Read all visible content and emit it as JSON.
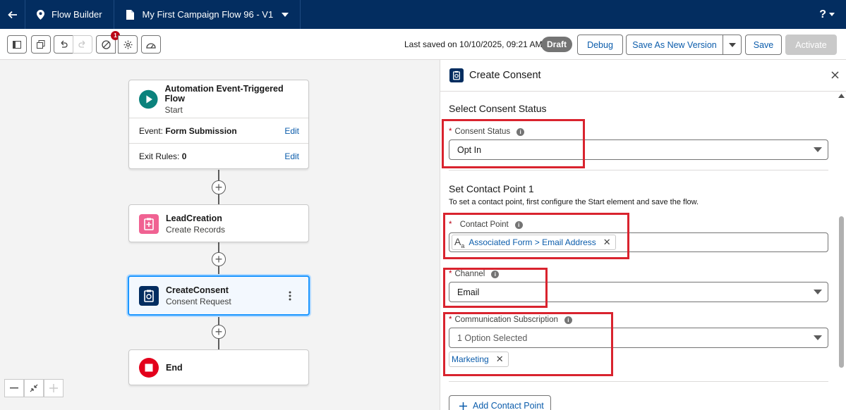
{
  "topbar": {
    "app_name": "Flow Builder",
    "flow_name": "My First Campaign Flow 96 - V1",
    "help": "?"
  },
  "toolbar": {
    "notification_count": "1",
    "last_saved": "Last saved on 10/10/2025, 09:21 AM",
    "status_badge": "Draft",
    "debug_label": "Debug",
    "save_as_new_label": "Save As New Version",
    "save_label": "Save",
    "activate_label": "Activate"
  },
  "canvas": {
    "start_node": {
      "title": "Automation Event-Triggered Flow",
      "subtitle": "Start",
      "event_label": "Event:",
      "event_value": "Form Submission",
      "exit_label": "Exit Rules:",
      "exit_value": "0",
      "edit_label": "Edit"
    },
    "lead_node": {
      "title": "LeadCreation",
      "subtitle": "Create Records"
    },
    "consent_node": {
      "title": "CreateConsent",
      "subtitle": "Consent Request"
    },
    "end_node": {
      "title": "End"
    }
  },
  "panel": {
    "title": "Create Consent",
    "section_consent_status": "Select Consent Status",
    "consent_status_label": "Consent Status",
    "consent_status_value": "Opt In",
    "section_contact_point": "Set Contact Point 1",
    "contact_point_help": "To set a contact point, first configure the Start element and save the flow.",
    "contact_point_label": "Contact Point",
    "contact_point_value": "Associated Form > Email Address",
    "channel_label": "Channel",
    "channel_value": "Email",
    "comm_sub_label": "Communication Subscription",
    "comm_sub_value": "1 Option Selected",
    "comm_sub_pill": "Marketing",
    "add_contact_point": "Add Contact Point"
  },
  "colors": {
    "brand_dark": "#032d60",
    "link_blue": "#0b5cab",
    "start_teal": "#0b827c",
    "lead_pink": "#f06292",
    "consent_navy": "#032d60",
    "end_red": "#e3001b",
    "annotation_red": "#d9232e"
  }
}
